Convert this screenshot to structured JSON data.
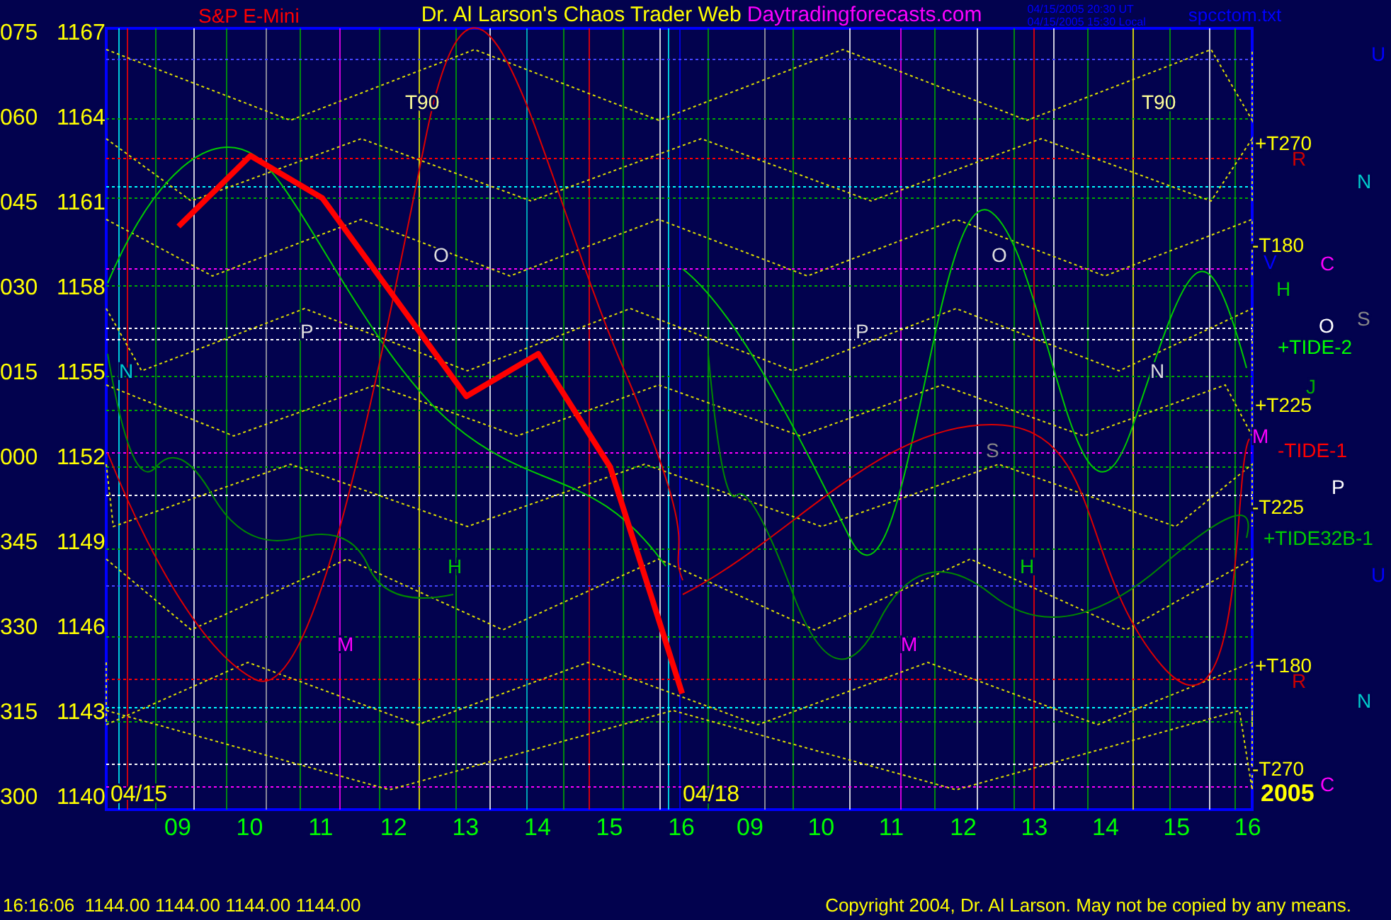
{
  "header": {
    "title": "Dr. Al Larson's Chaos Trader Web",
    "site": "Daytradingforecasts.com",
    "time_ut": "04/15/2005 20:30 UT",
    "time_local": "04/15/2005 15:30 Local",
    "file": "spcctom.txt"
  },
  "chart": {
    "chart_data": {
      "type": "line",
      "categories": [
        "09",
        "10",
        "11",
        "12",
        "13",
        "14",
        "15",
        "16",
        "09",
        "10",
        "11",
        "12",
        "13",
        "14",
        "15",
        "16"
      ],
      "series": [
        {
          "name": "S&P E-Mini",
          "color": "#ff0000",
          "values": [
            1160.1,
            1162.6,
            1161.1,
            1157.6,
            1154.1,
            1155.6,
            1151.6,
            1143.6,
            null,
            null,
            null,
            null,
            null,
            null,
            null,
            null
          ]
        }
      ],
      "ylim": [
        1139.5,
        1167.1
      ],
      "grid": true,
      "yticks": [
        {
          "value": 1167,
          "label": "1167"
        },
        {
          "value": 1164,
          "label": "1164"
        },
        {
          "value": 1161,
          "label": "1161"
        },
        {
          "value": 1158,
          "label": "1158"
        },
        {
          "value": 1155,
          "label": "1155"
        },
        {
          "value": 1152,
          "label": "1152"
        },
        {
          "value": 1149,
          "label": "1149"
        },
        {
          "value": 1146,
          "label": "1146"
        },
        {
          "value": 1143,
          "label": "1143"
        },
        {
          "value": 1140,
          "label": "1140"
        }
      ]
    },
    "angle_labels": [
      "075",
      "060",
      "045",
      "030",
      "015",
      "000",
      "345",
      "330",
      "315",
      "300"
    ],
    "date_labels": [
      "04/15",
      "04/18"
    ],
    "year": "2005",
    "annotations": [
      {
        "text": "T90",
        "color": "#ffff99"
      },
      {
        "text": "T90",
        "color": "#ffff99"
      },
      {
        "text": "O",
        "color": "#dddddd"
      },
      {
        "text": "O",
        "color": "#dddddd"
      },
      {
        "text": "P",
        "color": "#dddddd"
      },
      {
        "text": "P",
        "color": "#dddddd"
      },
      {
        "text": "N",
        "color": "#00cccc"
      },
      {
        "text": "N",
        "color": "#dddddd"
      },
      {
        "text": "H",
        "color": "#00cc00"
      },
      {
        "text": "H",
        "color": "#00cc00"
      },
      {
        "text": "M",
        "color": "#ff00ff"
      },
      {
        "text": "M",
        "color": "#ff00ff"
      },
      {
        "text": "S",
        "color": "#888888"
      },
      {
        "text": "U",
        "color": "#0000ff"
      },
      {
        "text": "+T270",
        "color": "#ffff00"
      },
      {
        "text": "R",
        "color": "#cc0000"
      },
      {
        "text": "N",
        "color": "#00cccc"
      },
      {
        "text": "-T180",
        "color": "#ffff00"
      },
      {
        "text": "V",
        "color": "#0000ff"
      },
      {
        "text": "C",
        "color": "#ff00ff"
      },
      {
        "text": "H",
        "color": "#00cc00"
      },
      {
        "text": "+TIDE-2",
        "color": "#00ff00"
      },
      {
        "text": "O",
        "color": "#ffffff"
      },
      {
        "text": "S",
        "color": "#888888"
      },
      {
        "text": "J",
        "color": "#00aa00"
      },
      {
        "text": "+T225",
        "color": "#ffff00"
      },
      {
        "text": "M",
        "color": "#ff00ff"
      },
      {
        "text": "-TIDE-1",
        "color": "#ff0000"
      },
      {
        "text": "P",
        "color": "#ffffff"
      },
      {
        "text": "-T225",
        "color": "#ffff00"
      },
      {
        "text": "+TIDE32B-1",
        "color": "#00cc00"
      },
      {
        "text": "U",
        "color": "#0000ff"
      },
      {
        "text": "+T180",
        "color": "#ffff00"
      },
      {
        "text": "R",
        "color": "#cc0000"
      },
      {
        "text": "N",
        "color": "#00cccc"
      },
      {
        "text": "-T270",
        "color": "#ffff00"
      },
      {
        "text": "C",
        "color": "#ff00ff"
      }
    ]
  },
  "status_bar": {
    "quote": "16:16:06  1144.00 1144.00 1144.00 1144.00",
    "copyright": "Copyright 2004, Dr. Al Larson. May not be copied by any means."
  }
}
